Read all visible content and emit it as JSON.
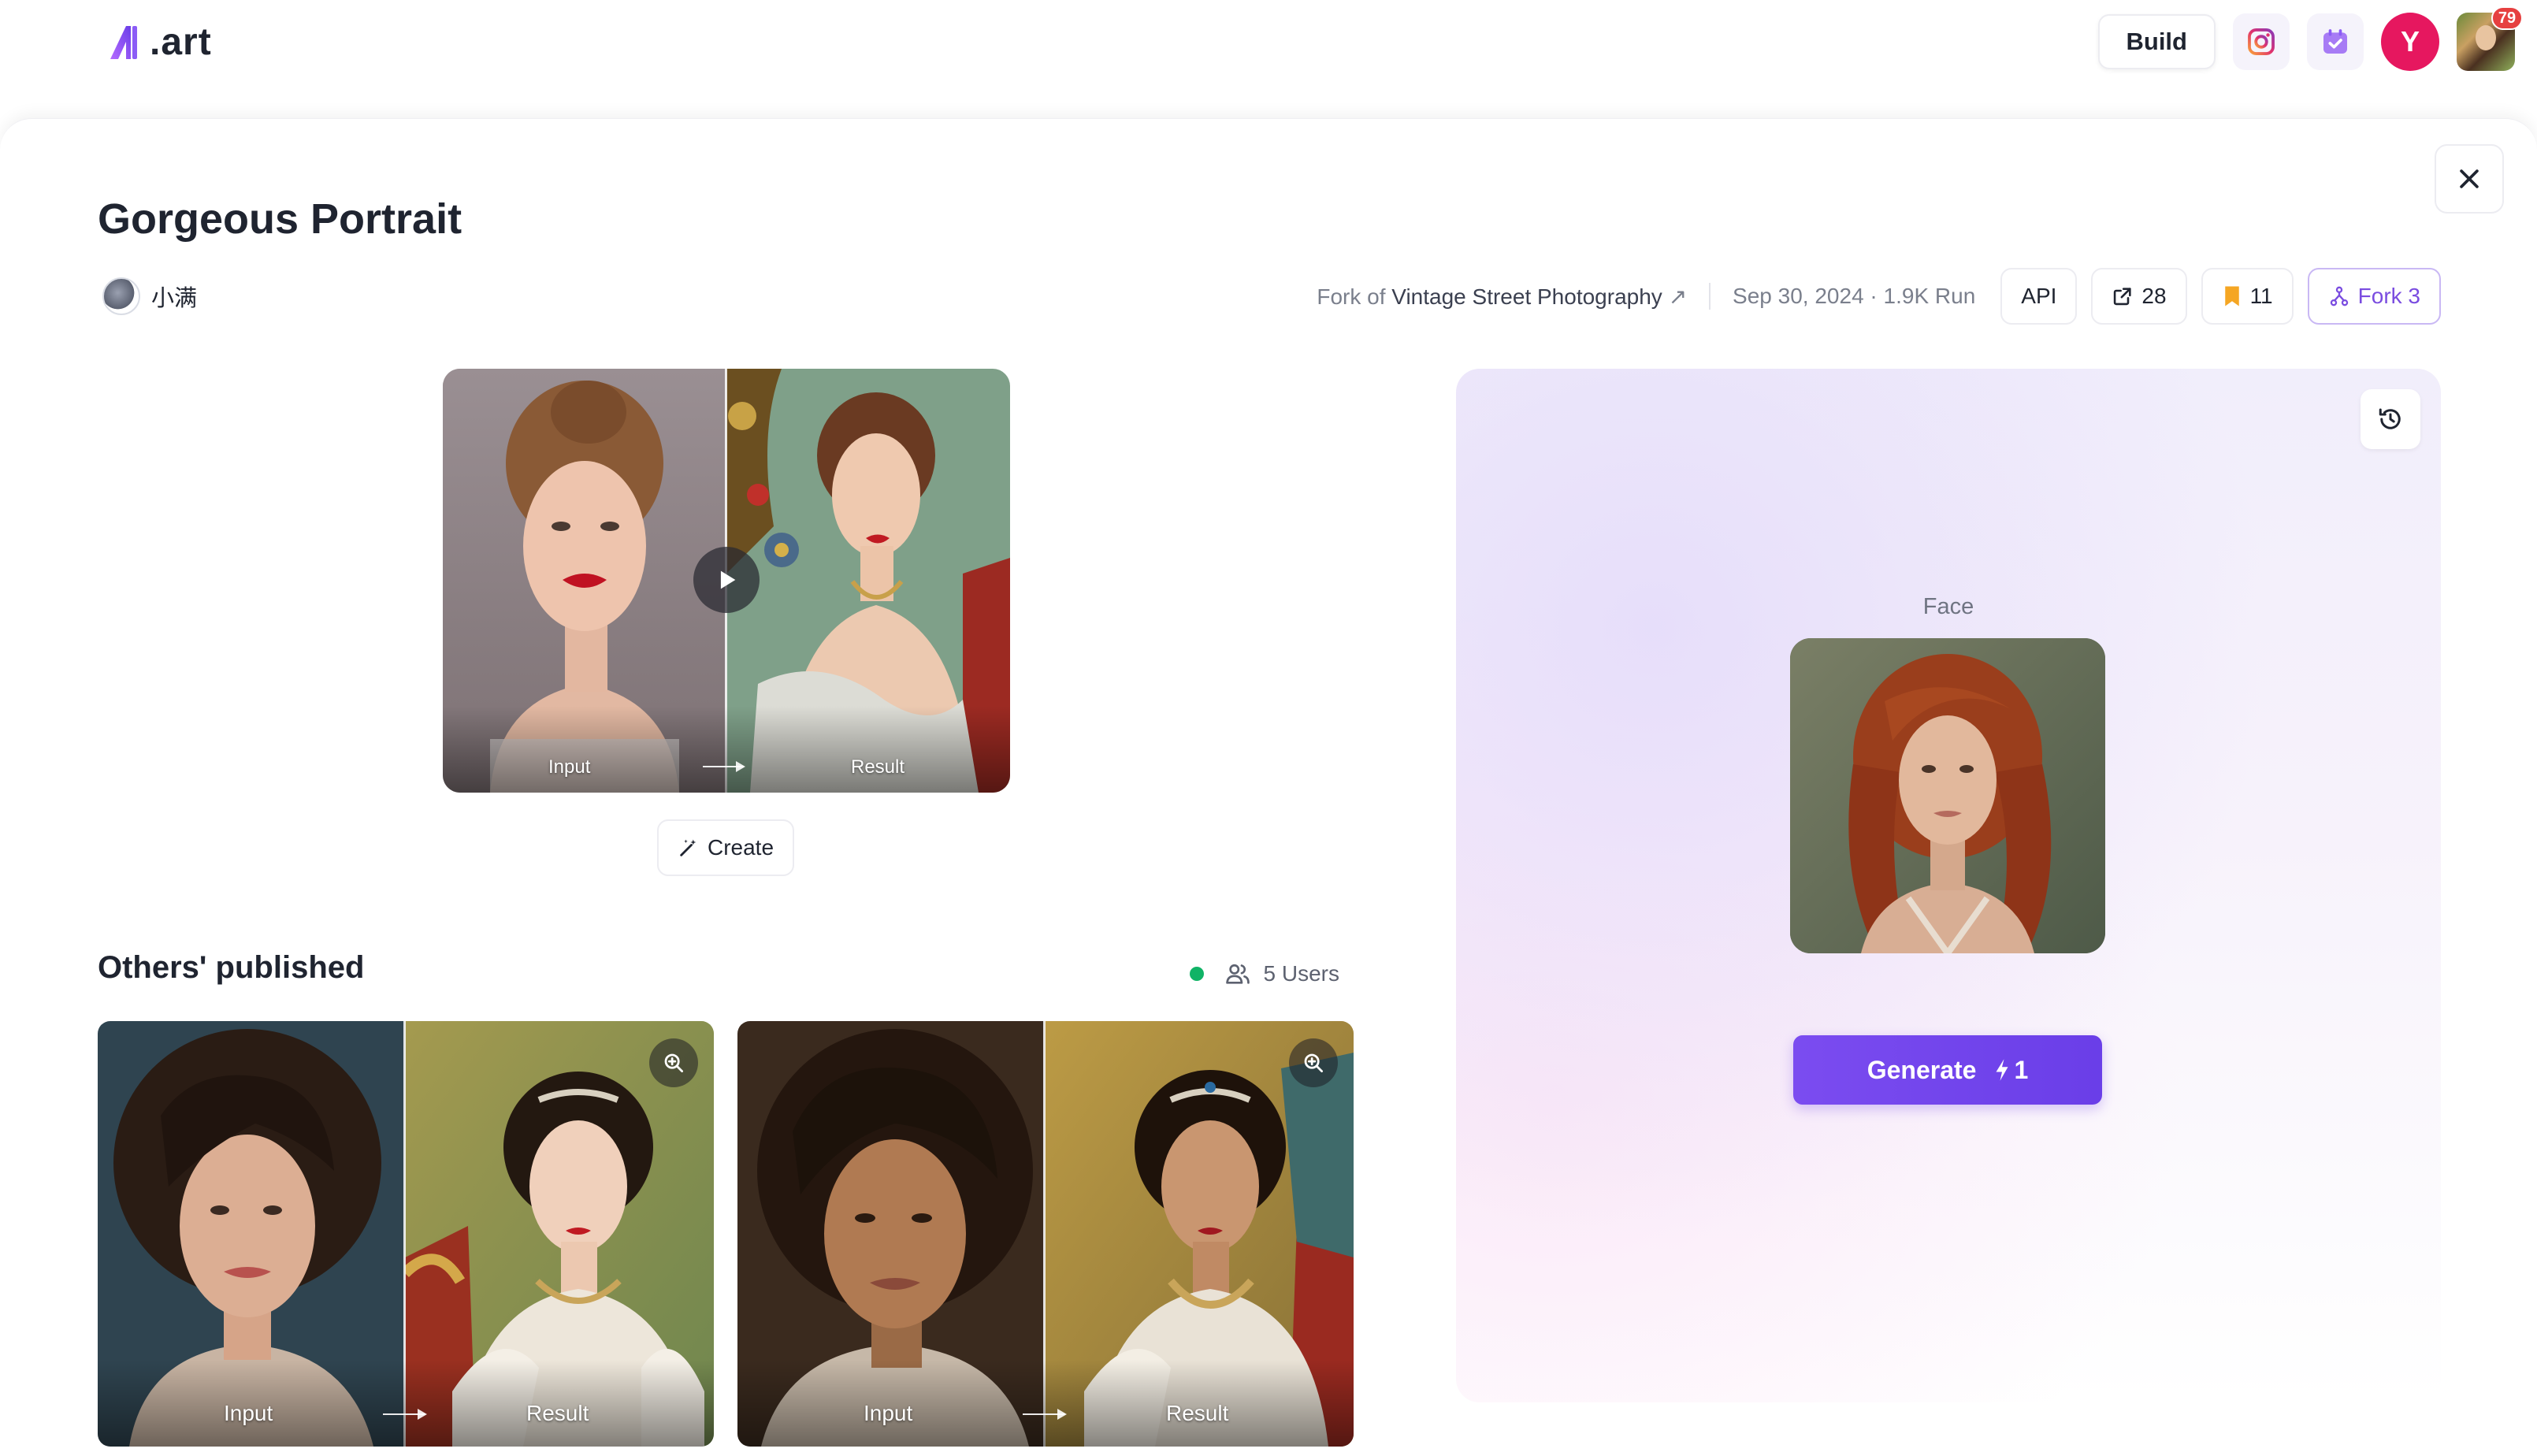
{
  "app": {
    "logo_text": ".art",
    "build_label": "Build",
    "user_initial": "Y",
    "notifications_count": "79"
  },
  "page": {
    "title": "Gorgeous Portrait",
    "author": "小满",
    "fork_of_prefix": "Fork of",
    "fork_of_name": "Vintage Street Photography",
    "fork_of_arrow": "↗",
    "date_runs": "Sep 30, 2024 · 1.9K Run",
    "api_label": "API",
    "shares_count": "28",
    "bookmarks_count": "11",
    "fork_label": "Fork 3"
  },
  "hero": {
    "input_label": "Input",
    "result_label": "Result",
    "create_label": "Create"
  },
  "others": {
    "title": "Others' published",
    "users_label": "5 Users",
    "cards": [
      {
        "input_label": "Input",
        "result_label": "Result"
      },
      {
        "input_label": "Input",
        "result_label": "Result"
      }
    ]
  },
  "generator": {
    "face_label": "Face",
    "generate_label": "Generate",
    "cost": "1"
  },
  "colors": {
    "accent": "#7a4ce0",
    "generate_button": "#6e40ea",
    "user_avatar": "#e6175f",
    "badge": "#e64040",
    "online_dot": "#10b366",
    "bookmark": "#f5a623"
  },
  "icons": [
    "logo-a-icon",
    "instagram-icon",
    "calendar-check-icon",
    "close-icon",
    "external-link-icon",
    "share-icon",
    "bookmark-icon",
    "fork-icon",
    "play-icon",
    "magic-wand-icon",
    "users-icon",
    "zoom-in-icon",
    "history-icon",
    "lightning-icon"
  ]
}
